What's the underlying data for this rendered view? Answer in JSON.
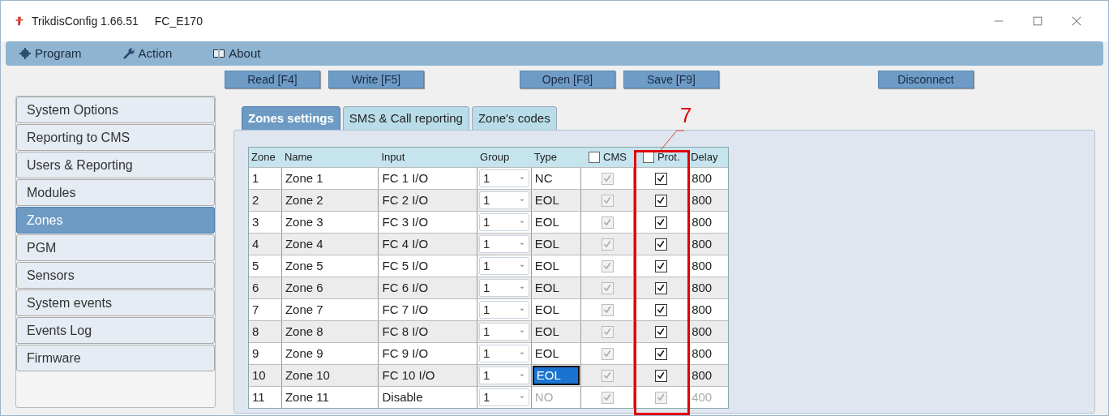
{
  "window": {
    "title": "TrikdisConfig 1.66.51",
    "device": "FC_E170"
  },
  "menu": [
    {
      "label": "Program"
    },
    {
      "label": "Action"
    },
    {
      "label": "About"
    }
  ],
  "toolbar": [
    {
      "label": "Read [F4]"
    },
    {
      "label": "Write [F5]"
    },
    {
      "label": "Open [F8]"
    },
    {
      "label": "Save [F9]"
    },
    {
      "label": "Disconnect"
    }
  ],
  "sidebar": {
    "items": [
      {
        "label": "System Options",
        "selected": false
      },
      {
        "label": "Reporting to CMS",
        "selected": false
      },
      {
        "label": "Users & Reporting",
        "selected": false
      },
      {
        "label": "Modules",
        "selected": false
      },
      {
        "label": "Zones",
        "selected": true
      },
      {
        "label": "PGM",
        "selected": false
      },
      {
        "label": "Sensors",
        "selected": false
      },
      {
        "label": "System events",
        "selected": false
      },
      {
        "label": "Events Log",
        "selected": false
      },
      {
        "label": "Firmware",
        "selected": false
      }
    ]
  },
  "tabs": [
    {
      "label": "Zones settings",
      "selected": true
    },
    {
      "label": "SMS & Call reporting",
      "selected": false
    },
    {
      "label": "Zone's codes",
      "selected": false
    }
  ],
  "table": {
    "columns": [
      {
        "label": "Zone"
      },
      {
        "label": "Name"
      },
      {
        "label": "Input"
      },
      {
        "label": "Group"
      },
      {
        "label": "Type"
      },
      {
        "label": "CMS",
        "checked": false
      },
      {
        "label": "Prot.",
        "checked": false
      },
      {
        "label": "Delay"
      }
    ],
    "rows": [
      {
        "zone": "1",
        "name": "Zone 1",
        "input": "FC 1 I/O",
        "group": "1",
        "type": "NC",
        "type_selected": false,
        "cms": true,
        "prot": true,
        "delay": "800",
        "disabled": false
      },
      {
        "zone": "2",
        "name": "Zone 2",
        "input": "FC 2 I/O",
        "group": "1",
        "type": "EOL",
        "type_selected": false,
        "cms": true,
        "prot": true,
        "delay": "800",
        "disabled": false
      },
      {
        "zone": "3",
        "name": "Zone 3",
        "input": "FC 3 I/O",
        "group": "1",
        "type": "EOL",
        "type_selected": false,
        "cms": true,
        "prot": true,
        "delay": "800",
        "disabled": false
      },
      {
        "zone": "4",
        "name": "Zone 4",
        "input": "FC 4 I/O",
        "group": "1",
        "type": "EOL",
        "type_selected": false,
        "cms": true,
        "prot": true,
        "delay": "800",
        "disabled": false
      },
      {
        "zone": "5",
        "name": "Zone 5",
        "input": "FC 5 I/O",
        "group": "1",
        "type": "EOL",
        "type_selected": false,
        "cms": true,
        "prot": true,
        "delay": "800",
        "disabled": false
      },
      {
        "zone": "6",
        "name": "Zone 6",
        "input": "FC 6 I/O",
        "group": "1",
        "type": "EOL",
        "type_selected": false,
        "cms": true,
        "prot": true,
        "delay": "800",
        "disabled": false
      },
      {
        "zone": "7",
        "name": "Zone 7",
        "input": "FC 7 I/O",
        "group": "1",
        "type": "EOL",
        "type_selected": false,
        "cms": true,
        "prot": true,
        "delay": "800",
        "disabled": false
      },
      {
        "zone": "8",
        "name": "Zone 8",
        "input": "FC 8 I/O",
        "group": "1",
        "type": "EOL",
        "type_selected": false,
        "cms": true,
        "prot": true,
        "delay": "800",
        "disabled": false
      },
      {
        "zone": "9",
        "name": "Zone 9",
        "input": "FC 9 I/O",
        "group": "1",
        "type": "EOL",
        "type_selected": false,
        "cms": true,
        "prot": true,
        "delay": "800",
        "disabled": false
      },
      {
        "zone": "10",
        "name": "Zone 10",
        "input": "FC 10 I/O",
        "group": "1",
        "type": "EOL",
        "type_selected": true,
        "cms": true,
        "prot": true,
        "delay": "800",
        "disabled": false
      },
      {
        "zone": "11",
        "name": "Zone 11",
        "input": "Disable",
        "group": "1",
        "type": "NO",
        "type_selected": false,
        "cms": true,
        "prot": true,
        "delay": "400",
        "disabled": true
      }
    ]
  },
  "callout": {
    "label": "7"
  }
}
